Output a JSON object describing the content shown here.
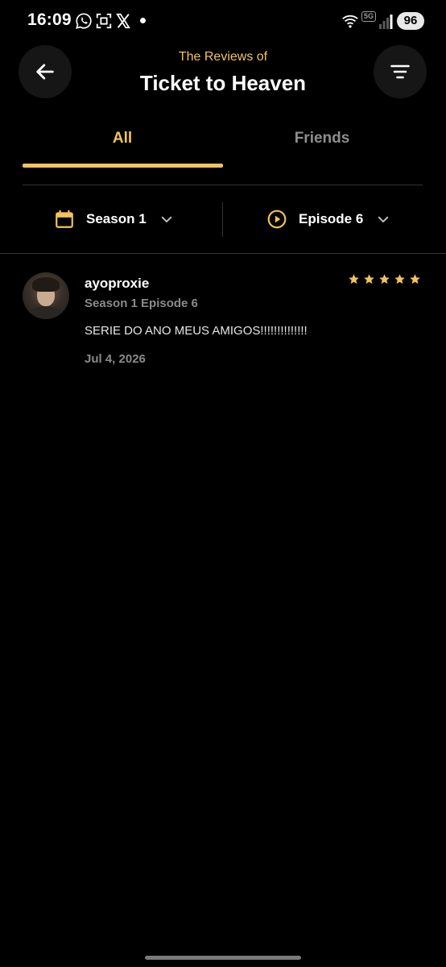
{
  "status_bar": {
    "time": "16:09",
    "network": "5G",
    "battery": "96",
    "notification_icons": [
      "whatsapp-icon",
      "screenshot-icon",
      "x-icon"
    ]
  },
  "header": {
    "subtitle": "The Reviews of",
    "title": "Ticket to Heaven",
    "back_icon": "arrow-left-icon",
    "sort_icon": "sort-icon"
  },
  "tabs": [
    {
      "label": "All",
      "selected": true
    },
    {
      "label": "Friends",
      "selected": false
    }
  ],
  "filters": {
    "season": {
      "label": "Season 1",
      "icon": "calendar-icon"
    },
    "episode": {
      "label": "Episode 6",
      "icon": "play-circle-icon"
    }
  },
  "reviews": [
    {
      "username": "ayoproxie",
      "episode_ref": "Season 1 Episode 6",
      "text": "SERIE DO ANO MEUS AMIGOS!!!!!!!!!!!!!!",
      "date": "Jul 4, 2026",
      "rating": 5,
      "rating_max": 5
    }
  ],
  "colors": {
    "accent": "#f3c35e",
    "background": "#000000",
    "muted_text": "#8a8a8a",
    "divider": "#333333"
  }
}
